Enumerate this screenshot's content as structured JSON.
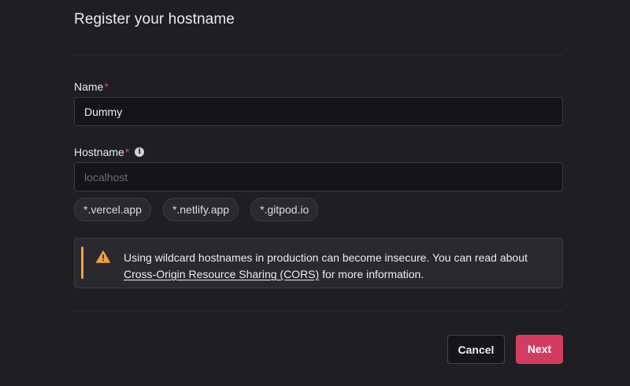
{
  "dialog": {
    "title": "Register your hostname"
  },
  "form": {
    "name": {
      "label": "Name",
      "required_mark": "*",
      "value": "Dummy"
    },
    "hostname": {
      "label": "Hostname",
      "required_mark": "*",
      "info_icon": "info-icon",
      "placeholder": "localhost",
      "value": ""
    },
    "suggestions": [
      "*.vercel.app",
      "*.netlify.app",
      "*.gitpod.io"
    ]
  },
  "warning": {
    "icon": "warning-triangle-icon",
    "accent_color": "#f2a23c",
    "text_before": "Using wildcard hostnames in production can become insecure. You can read about ",
    "link_text": "Cross-Origin Resource Sharing (CORS)",
    "text_after": " for more information."
  },
  "actions": {
    "cancel_label": "Cancel",
    "next_label": "Next",
    "primary_color": "#d23c61"
  }
}
